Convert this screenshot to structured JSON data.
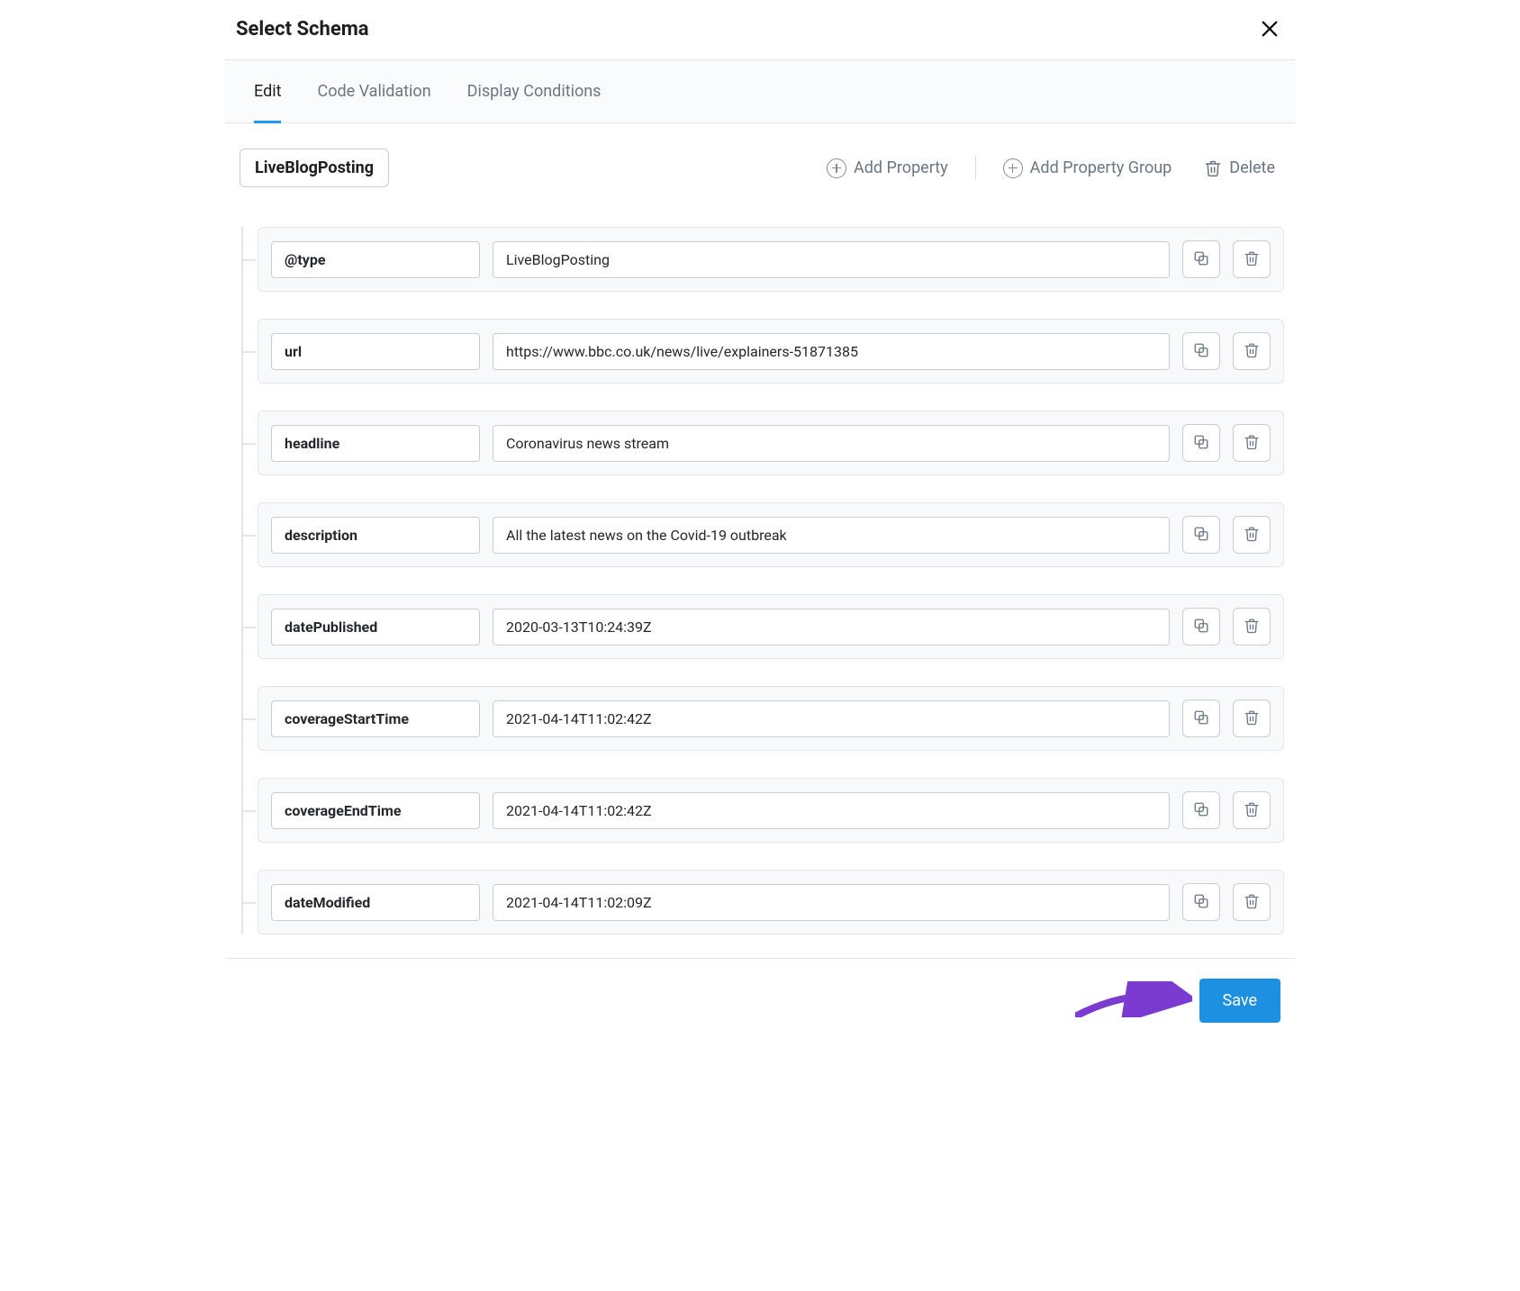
{
  "header": {
    "title": "Select Schema"
  },
  "tabs": {
    "edit": "Edit",
    "code_validation": "Code Validation",
    "display_conditions": "Display Conditions",
    "active_index": 0
  },
  "toolbar": {
    "schema_tag": "LiveBlogPosting",
    "add_property_label": "Add Property",
    "add_property_group_label": "Add Property Group",
    "delete_label": "Delete"
  },
  "rows": [
    {
      "key": "@type",
      "value": "LiveBlogPosting"
    },
    {
      "key": "url",
      "value": "https://www.bbc.co.uk/news/live/explainers-51871385"
    },
    {
      "key": "headline",
      "value": "Coronavirus news stream"
    },
    {
      "key": "description",
      "value": "All the latest news on the Covid-19 outbreak"
    },
    {
      "key": "datePublished",
      "value": "2020-03-13T10:24:39Z"
    },
    {
      "key": "coverageStartTime",
      "value": "2021-04-14T11:02:42Z"
    },
    {
      "key": "coverageEndTime",
      "value": "2021-04-14T11:02:42Z"
    },
    {
      "key": "dateModified",
      "value": "2021-04-14T11:02:09Z"
    }
  ],
  "footer": {
    "save_label": "Save"
  },
  "colors": {
    "accent": "#2196f3",
    "save": "#1e90e2",
    "arrow": "#7b3bd0"
  }
}
